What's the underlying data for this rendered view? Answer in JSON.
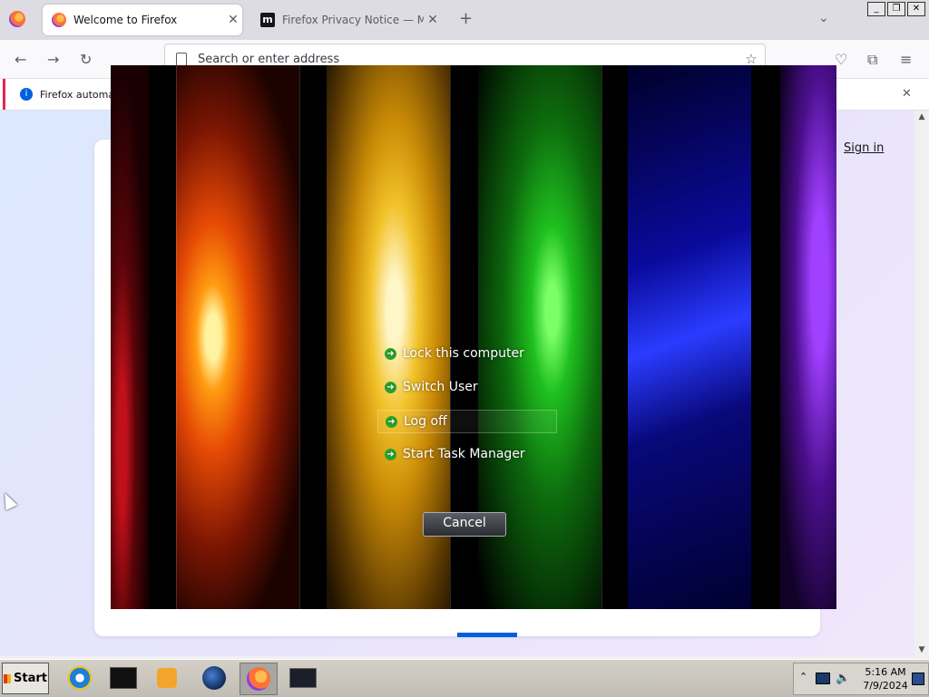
{
  "browser": {
    "tabs": [
      {
        "label": "Welcome to Firefox",
        "active": true
      },
      {
        "label": "Firefox Privacy Notice — Mozilla",
        "active": false
      }
    ],
    "newtab_glyph": "+",
    "address_placeholder": "Search or enter address",
    "infobar_text": "Firefox automat",
    "signin_label": "Sign in"
  },
  "security_screen": {
    "options": [
      {
        "label": "Lock this computer"
      },
      {
        "label": "Switch User"
      },
      {
        "label": "Log off"
      },
      {
        "label": "Start Task Manager"
      }
    ],
    "cancel_label": "Cancel"
  },
  "taskbar": {
    "start_label": "Start",
    "apps": [
      "internet-explorer-icon",
      "terminal-icon",
      "media-player-icon",
      "globe-icon",
      "firefox-icon",
      "display-icon"
    ],
    "clock_time": "5:16 AM",
    "clock_date": "7/9/2024"
  },
  "colors": {
    "accent": "#0060df",
    "option_arrow": "#2aa52a"
  }
}
